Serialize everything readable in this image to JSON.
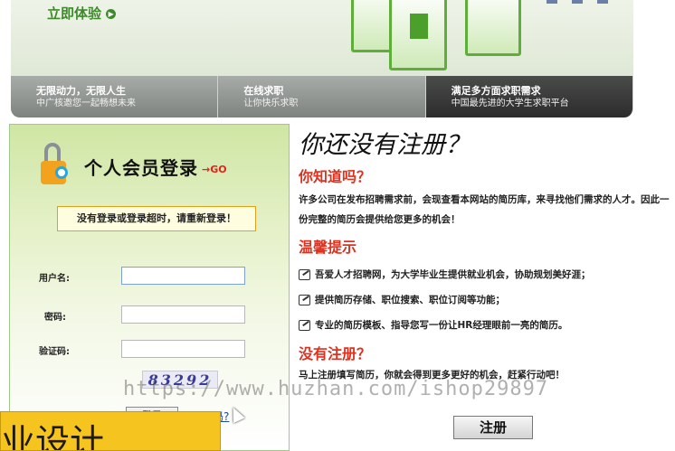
{
  "banner": {
    "trial_button": "立即体验",
    "tabs": [
      {
        "title": "无限动力，无限人生",
        "subtitle": "中广核邀您一起畅想未来"
      },
      {
        "title": "在线求职",
        "subtitle": "让你快乐求职"
      },
      {
        "title": "满足多方面求职需求",
        "subtitle": "中国最先进的大学生求职平台"
      }
    ]
  },
  "login": {
    "title": "个人会员登录",
    "go": "GO",
    "notice": "没有登录或登录超时，请重新登录！",
    "username_label": "用户名:",
    "password_label": "密码:",
    "captcha_label": "验证码:",
    "captcha_code": "83292",
    "submit": "登录",
    "forgot": "码?"
  },
  "info": {
    "heading": "你还没有注册？",
    "know_title": "你知道吗？",
    "know_text": "许多公司在发布招聘需求前，会现查看本网站的简历库，来寻找他们需求的人才。因此一份完整的简历会提供给您更多的机会！",
    "tips_title": "温馨提示",
    "tips": [
      "吾爱人才招聘网，为大学毕业生提供就业机会，协助规划美好涯；",
      "提供简历存储、职位搜索、职位订阅等功能；",
      "专业的简历模板、指导您写一份让HR经理眼前一亮的简历。"
    ],
    "unreg_title": "没有注册？",
    "unreg_text": "马上注册填写简历，你就会得到更多更好的机会，赶紧行动吧！",
    "register_button": "注册"
  },
  "overlay": {
    "watermark": "https://www.huzhan.com/ishop29897",
    "yellow_text": "业设计"
  }
}
